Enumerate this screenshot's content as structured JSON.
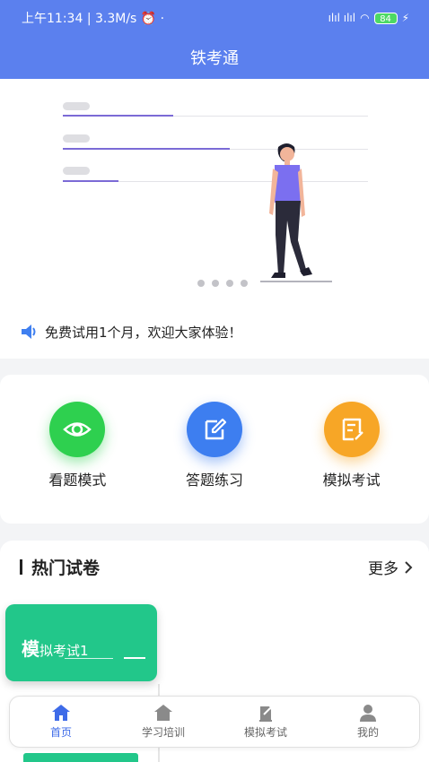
{
  "status_bar": {
    "time": "上午11:34",
    "speed": "3.3M/s",
    "battery": "84"
  },
  "app": {
    "title": "铁考通"
  },
  "notice": {
    "text": "免费试用1个月，欢迎大家体验！"
  },
  "features": [
    {
      "label": "看题模式",
      "color": "#2ed04f",
      "icon": "eye-icon"
    },
    {
      "label": "答题练习",
      "color": "#3d7ef0",
      "icon": "edit-icon"
    },
    {
      "label": "模拟考试",
      "color": "#f7a626",
      "icon": "exam-icon"
    }
  ],
  "hot_papers": {
    "title": "热门试卷",
    "more_label": "更多",
    "items": [
      {
        "big_char": "模",
        "rest": "拟考试1"
      }
    ]
  },
  "tabs": [
    {
      "label": "首页",
      "icon": "home-icon",
      "active": true
    },
    {
      "label": "学习培训",
      "icon": "study-icon",
      "active": false
    },
    {
      "label": "模拟考试",
      "icon": "exam-tab-icon",
      "active": false
    },
    {
      "label": "我的",
      "icon": "profile-icon",
      "active": false
    }
  ],
  "colors": {
    "primary": "#5b80ee",
    "accent_green": "#22c78a",
    "tab_active": "#3e6be8"
  }
}
